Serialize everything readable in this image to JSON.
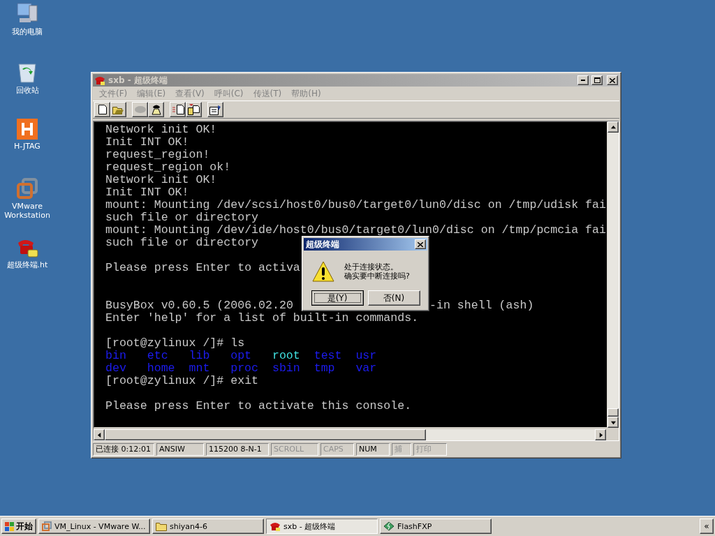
{
  "desktop_icons": [
    {
      "kind": "computer",
      "label": "我的电脑"
    },
    {
      "kind": "recycle",
      "label": "回收站"
    },
    {
      "kind": "hjtag",
      "label": "H-JTAG"
    },
    {
      "kind": "vmware",
      "label": "VMware Workstation"
    },
    {
      "kind": "phone",
      "label": "超级终端.ht"
    }
  ],
  "window": {
    "title": "sxb - 超级终端",
    "active": false,
    "menu": [
      "文件(F)",
      "编辑(E)",
      "查看(V)",
      "呼叫(C)",
      "传送(T)",
      "帮助(H)"
    ],
    "toolbar": [
      {
        "kind": "new",
        "disabled": false
      },
      {
        "kind": "open",
        "disabled": false
      },
      {
        "kind": "disconnect",
        "disabled": true
      },
      {
        "kind": "call",
        "disabled": false
      },
      {
        "kind": "send",
        "disabled": false
      },
      {
        "kind": "receive",
        "disabled": false
      },
      {
        "kind": "properties",
        "disabled": false
      }
    ],
    "terminal": [
      {
        "kind": "text",
        "parts": [
          "Network init OK!"
        ]
      },
      {
        "kind": "text",
        "parts": [
          "Init INT OK!"
        ]
      },
      {
        "kind": "text",
        "parts": [
          "request_region!"
        ]
      },
      {
        "kind": "text",
        "parts": [
          "request_region ok!"
        ]
      },
      {
        "kind": "text",
        "parts": [
          "Network init OK!"
        ]
      },
      {
        "kind": "text",
        "parts": [
          "Init INT OK!"
        ]
      },
      {
        "kind": "text",
        "parts": [
          "mount: Mounting /dev/scsi/host0/bus0/target0/lun0/disc on /tmp/udisk fai"
        ]
      },
      {
        "kind": "text",
        "parts": [
          "such file or directory"
        ]
      },
      {
        "kind": "text",
        "parts": [
          "mount: Mounting /dev/ide/host0/bus0/target0/lun0/disc on /tmp/pcmcia fai"
        ]
      },
      {
        "kind": "text",
        "parts": [
          "such file or directory"
        ]
      },
      {
        "kind": "blank"
      },
      {
        "kind": "text",
        "parts": [
          "Please press Enter to activa"
        ]
      },
      {
        "kind": "blank"
      },
      {
        "kind": "blank"
      },
      {
        "kind": "text",
        "parts": [
          "BusyBox v0.60.5 (2006.02.20",
          "-in shell (ash)"
        ]
      },
      {
        "kind": "text",
        "parts": [
          "Enter 'help' for a list of built-in commands."
        ]
      },
      {
        "kind": "blank"
      },
      {
        "kind": "text",
        "parts": [
          "[root@zylinux /]# ls"
        ]
      },
      {
        "kind": "listing",
        "items": [
          {
            "text": "bin",
            "color": "#1c1cf0"
          },
          {
            "text": "etc",
            "color": "#1c1cf0"
          },
          {
            "text": "lib",
            "color": "#1c1cf0"
          },
          {
            "text": "opt",
            "color": "#1c1cf0"
          },
          {
            "text": "root",
            "color": "#40e0e0"
          },
          {
            "text": "test",
            "color": "#1c1cf0"
          },
          {
            "text": "usr",
            "color": "#1c1cf0"
          }
        ]
      },
      {
        "kind": "listing",
        "items": [
          {
            "text": "dev",
            "color": "#1c1cf0"
          },
          {
            "text": "home",
            "color": "#1c1cf0"
          },
          {
            "text": "mnt",
            "color": "#1c1cf0"
          },
          {
            "text": "proc",
            "color": "#1c1cf0"
          },
          {
            "text": "sbin",
            "color": "#1c1cf0"
          },
          {
            "text": "tmp",
            "color": "#1c1cf0"
          },
          {
            "text": "var",
            "color": "#1c1cf0"
          }
        ]
      },
      {
        "kind": "text",
        "parts": [
          "[root@zylinux /]# exit"
        ]
      },
      {
        "kind": "blank"
      },
      {
        "kind": "text",
        "parts": [
          "Please press Enter to activate this console."
        ]
      }
    ],
    "status_bar": [
      {
        "text": "已连接 0:12:01",
        "on": true
      },
      {
        "text": "ANSIW",
        "on": true
      },
      {
        "text": "115200 8-N-1",
        "on": true
      },
      {
        "text": "SCROLL",
        "on": false
      },
      {
        "text": "CAPS",
        "on": false
      },
      {
        "text": "NUM",
        "on": true
      },
      {
        "text": "捕",
        "on": false
      },
      {
        "text": "打印",
        "on": false
      }
    ]
  },
  "dialog": {
    "title": "超级终端",
    "message": [
      "处于连接状态。",
      "确实要中断连接吗?"
    ],
    "buttons": [
      {
        "label": "是(Y)",
        "focused": true
      },
      {
        "label": "否(N)",
        "focused": false
      }
    ]
  },
  "taskbar": {
    "start": "开始",
    "tasks": [
      {
        "kind": "vmware",
        "label": "VM_Linux - VMware W...",
        "selected": false
      },
      {
        "kind": "folder",
        "label": "shiyan4-6",
        "selected": false
      },
      {
        "kind": "phone",
        "label": "sxb - 超级终端",
        "selected": true
      },
      {
        "kind": "ftp",
        "label": "FlashFXP",
        "selected": false
      }
    ],
    "tray": "«"
  }
}
